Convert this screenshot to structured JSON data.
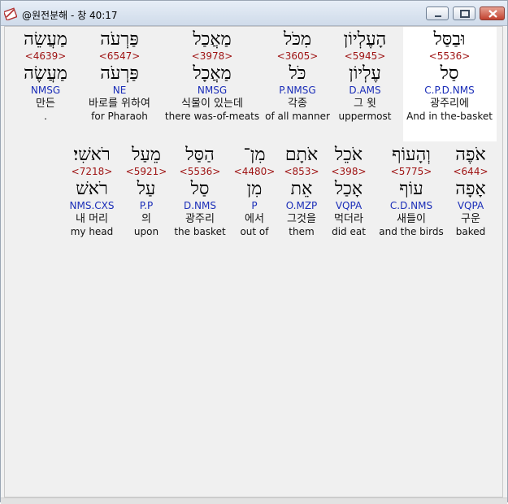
{
  "window": {
    "title": "@원전분해 - 창 40:17",
    "controls": {
      "minimize": "minimize",
      "maximize": "maximize",
      "close": "close"
    }
  },
  "rows": [
    {
      "words": [
        {
          "hebrew": "וּבַסַּל",
          "strong": "<5536>",
          "lemma": "סַל",
          "morph": "C.P.D.NMS",
          "korean": "광주리에",
          "english": "And in the-basket"
        },
        {
          "hebrew": "הָעֶלְיוֹן",
          "strong": "<5945>",
          "lemma": "עֶלְיוֹן",
          "morph": "D.AMS",
          "korean": "그 윗",
          "english": "uppermost"
        },
        {
          "hebrew": "מִכֹּל",
          "strong": "<3605>",
          "lemma": "כֹּל",
          "morph": "P.NMSG",
          "korean": "각종",
          "english": "of all manner"
        },
        {
          "hebrew": "מַאֲכַל",
          "strong": "<3978>",
          "lemma": "מַאֲכָל",
          "morph": "NMSG",
          "korean": "식물이 있는데",
          "english": "there was-of-meats"
        },
        {
          "hebrew": "פַּרְעֹה",
          "strong": "<6547>",
          "lemma": "פַּרְעֹה",
          "morph": "NE",
          "korean": "바로를 위하여",
          "english": "for Pharaoh"
        },
        {
          "hebrew": "מַעֲשֵׂה",
          "strong": "<4639>",
          "lemma": "מַעֲשֶׂה",
          "morph": "NMSG",
          "korean": "만든",
          "english": "."
        }
      ]
    },
    {
      "words": [
        {
          "hebrew": "אֹפֶה",
          "strong": "<644>",
          "lemma": "אָפָה",
          "morph": "VQPA",
          "korean": "구운",
          "english": "baked"
        },
        {
          "hebrew": "וְהָעוֹף",
          "strong": "<5775>",
          "lemma": "עוֹף",
          "morph": "C.D.NMS",
          "korean": "새들이",
          "english": "and the birds"
        },
        {
          "hebrew": "אֹכֵל",
          "strong": "<398>",
          "lemma": "אָכַל",
          "morph": "VQPA",
          "korean": "먹더라",
          "english": "did eat"
        },
        {
          "hebrew": "אֹתָם",
          "strong": "<853>",
          "lemma": "אֵת",
          "morph": "O.MZP",
          "korean": "그것을",
          "english": "them"
        },
        {
          "hebrew": "מִן־",
          "strong": "<4480>",
          "lemma": "מִן",
          "morph": "P",
          "korean": "에서",
          "english": "out of"
        },
        {
          "hebrew": "הַסַּל",
          "strong": "<5536>",
          "lemma": "סַל",
          "morph": "D.NMS",
          "korean": "광주리",
          "english": "the basket"
        },
        {
          "hebrew": "מֵעַל",
          "strong": "<5921>",
          "lemma": "עַל",
          "morph": "P.P",
          "korean": "의",
          "english": "upon"
        },
        {
          "hebrew": "רֹאשִׁי׃",
          "strong": "<7218>",
          "lemma": "רֹאשׁ",
          "morph": "NMS.CXS",
          "korean": "내 머리",
          "english": "my head"
        }
      ]
    }
  ],
  "colors": {
    "strong": "#9e1212",
    "morph": "#1a2db8",
    "selected_background": "#ffffff"
  }
}
